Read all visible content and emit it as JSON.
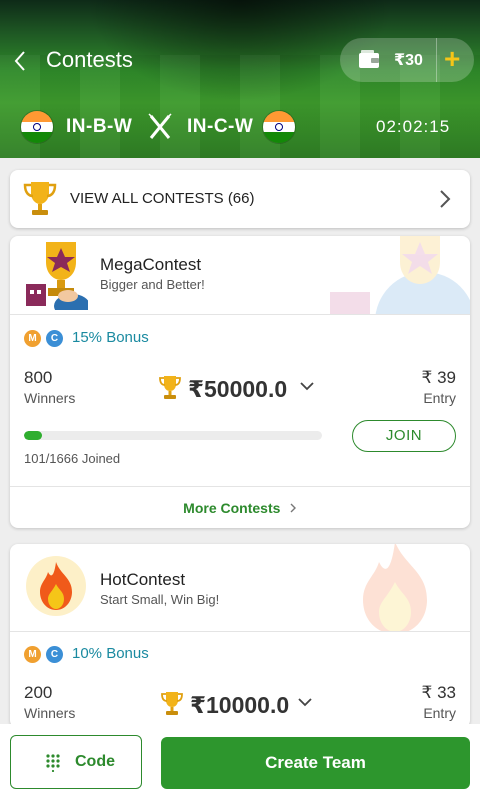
{
  "header": {
    "title": "Contests",
    "wallet_amount": "₹30",
    "wallet_add": "+",
    "team_a": "IN-B-W",
    "team_b": "IN-C-W",
    "timer": "02:02:15"
  },
  "view_all": {
    "label": "VIEW ALL CONTESTS (66)"
  },
  "contests": [
    {
      "name": "MegaContest",
      "subtitle": "Bigger and Better!",
      "coin_m": "M",
      "coin_c": "C",
      "bonus": "15% Bonus",
      "winners": "800",
      "winners_label": "Winners",
      "prize": "₹50000.0",
      "entry_fee": "₹ 39",
      "entry_label": "Entry",
      "joined": "101/1666 Joined",
      "joined_fraction": 0.061,
      "join_label": "JOIN",
      "more_label": "More Contests"
    },
    {
      "name": "HotContest",
      "subtitle": "Start Small, Win Big!",
      "coin_m": "M",
      "coin_c": "C",
      "bonus": "10% Bonus",
      "winners": "200",
      "winners_label": "Winners",
      "prize": "₹10000.0",
      "entry_fee": "₹ 33",
      "entry_label": "Entry"
    }
  ],
  "footer": {
    "code_label": "Code",
    "create_label": "Create Team"
  },
  "colors": {
    "brand_green": "#2d962d",
    "bonus_teal": "#1a8aa0",
    "coin_m": "#f0a030",
    "coin_c": "#3b8fd6",
    "gold": "#f5c518"
  }
}
